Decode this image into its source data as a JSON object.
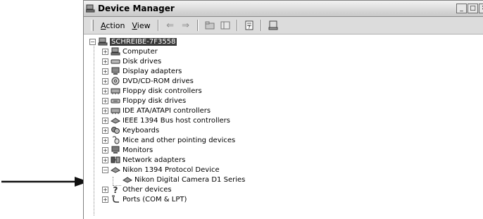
{
  "window": {
    "title": "Device Manager",
    "controls": [
      "_",
      "□",
      "✕"
    ]
  },
  "toolbar": {
    "menus": [
      "Action",
      "View"
    ]
  },
  "tree": {
    "root": "SCHREIBE-7F3558",
    "items": [
      {
        "label": "Computer",
        "icon": "computer-icon"
      },
      {
        "label": "Disk drives",
        "icon": "disk-drive-icon"
      },
      {
        "label": "Display adapters",
        "icon": "display-adapter-icon"
      },
      {
        "label": "DVD/CD-ROM drives",
        "icon": "cdrom-icon"
      },
      {
        "label": "Floppy disk controllers",
        "icon": "controller-icon"
      },
      {
        "label": "Floppy disk drives",
        "icon": "floppy-icon"
      },
      {
        "label": "IDE ATA/ATAPI controllers",
        "icon": "controller-icon"
      },
      {
        "label": "IEEE 1394 Bus host controllers",
        "icon": "bus-icon"
      },
      {
        "label": "Keyboards",
        "icon": "keyboard-icon"
      },
      {
        "label": "Mice and other pointing devices",
        "icon": "mouse-icon"
      },
      {
        "label": "Monitors",
        "icon": "monitor-icon"
      },
      {
        "label": "Network adapters",
        "icon": "network-icon"
      },
      {
        "label": "Nikon 1394 Protocol Device",
        "icon": "bus-icon"
      },
      {
        "label": "Nikon Digital Camera D1 Series",
        "icon": "camera-device-icon"
      },
      {
        "label": "Other devices",
        "icon": "question-icon"
      },
      {
        "label": "Ports (COM & LPT)",
        "icon": "port-icon"
      }
    ]
  }
}
